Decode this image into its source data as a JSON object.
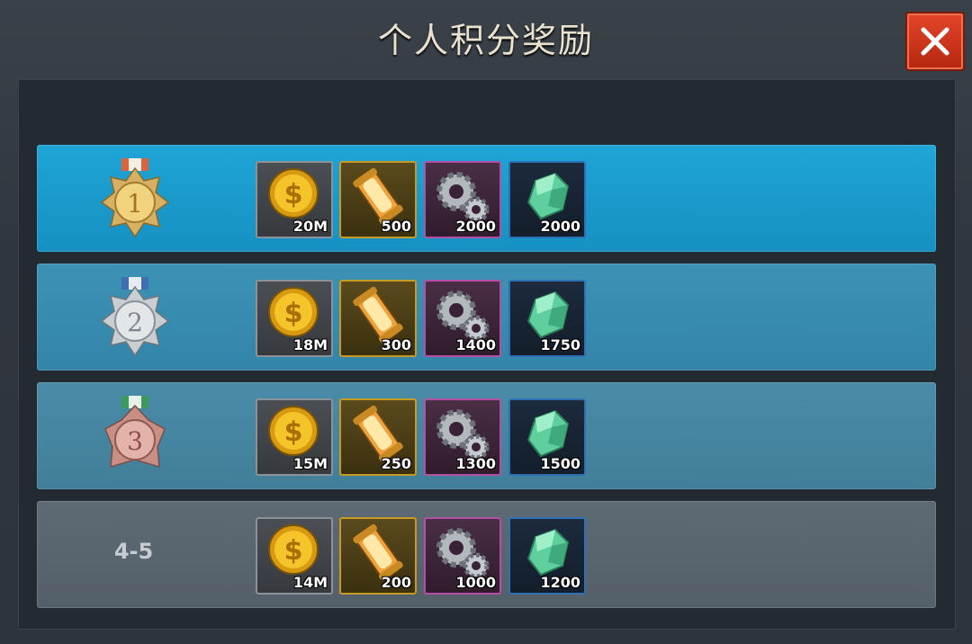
{
  "header": {
    "title": "个人积分奖励"
  },
  "colors": {
    "row_1": "#1fa5d6",
    "row_2": "#3c92b5",
    "row_3": "#4a8ca8",
    "row_4": "#5d6a74",
    "close": "#d23a1e"
  },
  "icons": {
    "coin": "coin-icon",
    "ammo": "ammo-canister-icon",
    "gear": "gear-icon",
    "gem": "gem-icon",
    "medal_gold": "gold-medal-icon",
    "medal_silver": "silver-medal-icon",
    "medal_bronze": "bronze-medal-icon",
    "close": "close-icon"
  },
  "rows": [
    {
      "rank": "1",
      "medal": "gold",
      "rewards": {
        "coin": "20M",
        "ammo": "500",
        "gear": "2000",
        "gem": "2000"
      }
    },
    {
      "rank": "2",
      "medal": "silver",
      "rewards": {
        "coin": "18M",
        "ammo": "300",
        "gear": "1400",
        "gem": "1750"
      }
    },
    {
      "rank": "3",
      "medal": "bronze",
      "rewards": {
        "coin": "15M",
        "ammo": "250",
        "gear": "1300",
        "gem": "1500"
      }
    },
    {
      "rank": "4-5",
      "medal": "",
      "rewards": {
        "coin": "14M",
        "ammo": "200",
        "gear": "1000",
        "gem": "1200"
      }
    }
  ]
}
